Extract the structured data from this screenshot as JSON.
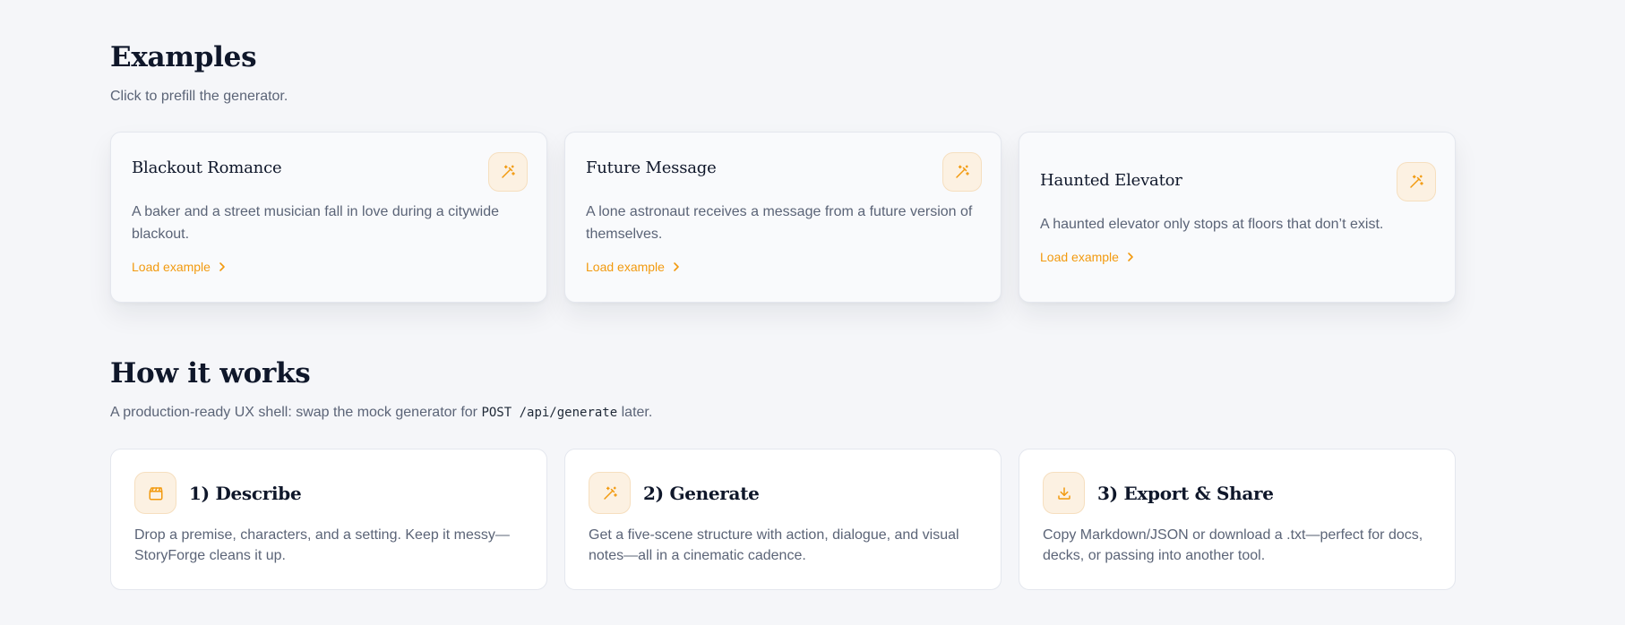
{
  "examples": {
    "title": "Examples",
    "subtitle": "Click to prefill the generator.",
    "cards": [
      {
        "title": "Blackout Romance",
        "description": "A baker and a street musician fall in love during a citywide blackout.",
        "link": "Load example",
        "icon": "magic-wand-icon"
      },
      {
        "title": "Future Message",
        "description": "A lone astronaut receives a message from a future version of themselves.",
        "link": "Load example",
        "icon": "magic-wand-icon"
      },
      {
        "title": "Haunted Elevator",
        "description": "A haunted elevator only stops at floors that don’t exist.",
        "link": "Load example",
        "icon": "magic-wand-icon"
      }
    ]
  },
  "how": {
    "title": "How it works",
    "subtitle_before": "A production-ready UX shell: swap the mock generator for",
    "subtitle_code": "POST /api/generate",
    "subtitle_after": "later.",
    "steps": [
      {
        "title": "1) Describe",
        "description": "Drop a premise, characters, and a setting. Keep it messy—StoryForge cleans it up.",
        "icon": "clapperboard-icon"
      },
      {
        "title": "2) Generate",
        "description": "Get a five-scene structure with action, dialogue, and visual notes—all in a cinematic cadence.",
        "icon": "magic-wand-icon"
      },
      {
        "title": "3) Export & Share",
        "description": "Copy Markdown/JSON or download a .txt—perfect for docs, decks, or passing into another tool.",
        "icon": "download-icon"
      }
    ]
  },
  "colors": {
    "accent": "#f29a0f",
    "icon_bg": "#fcf1e2",
    "heading": "#0f172a",
    "muted": "#5b6477",
    "page_bg": "#f5f6f9"
  }
}
